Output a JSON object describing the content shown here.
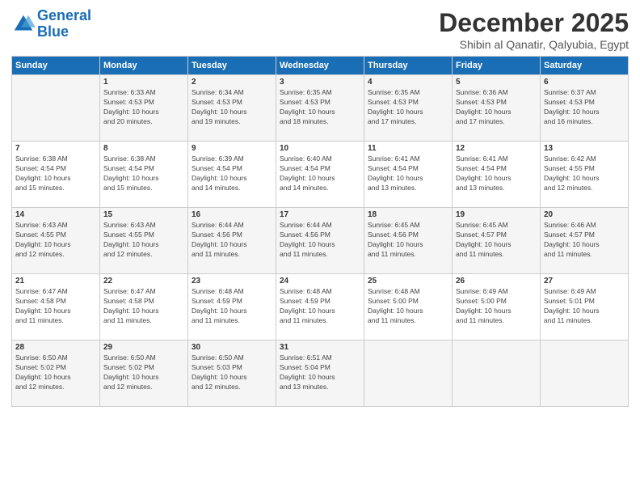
{
  "logo": {
    "line1": "General",
    "line2": "Blue"
  },
  "title": "December 2025",
  "subtitle": "Shibin al Qanatir, Qalyubia, Egypt",
  "days_of_week": [
    "Sunday",
    "Monday",
    "Tuesday",
    "Wednesday",
    "Thursday",
    "Friday",
    "Saturday"
  ],
  "weeks": [
    [
      {
        "day": "",
        "info": ""
      },
      {
        "day": "1",
        "info": "Sunrise: 6:33 AM\nSunset: 4:53 PM\nDaylight: 10 hours\nand 20 minutes."
      },
      {
        "day": "2",
        "info": "Sunrise: 6:34 AM\nSunset: 4:53 PM\nDaylight: 10 hours\nand 19 minutes."
      },
      {
        "day": "3",
        "info": "Sunrise: 6:35 AM\nSunset: 4:53 PM\nDaylight: 10 hours\nand 18 minutes."
      },
      {
        "day": "4",
        "info": "Sunrise: 6:35 AM\nSunset: 4:53 PM\nDaylight: 10 hours\nand 17 minutes."
      },
      {
        "day": "5",
        "info": "Sunrise: 6:36 AM\nSunset: 4:53 PM\nDaylight: 10 hours\nand 17 minutes."
      },
      {
        "day": "6",
        "info": "Sunrise: 6:37 AM\nSunset: 4:53 PM\nDaylight: 10 hours\nand 16 minutes."
      }
    ],
    [
      {
        "day": "7",
        "info": "Sunrise: 6:38 AM\nSunset: 4:54 PM\nDaylight: 10 hours\nand 15 minutes."
      },
      {
        "day": "8",
        "info": "Sunrise: 6:38 AM\nSunset: 4:54 PM\nDaylight: 10 hours\nand 15 minutes."
      },
      {
        "day": "9",
        "info": "Sunrise: 6:39 AM\nSunset: 4:54 PM\nDaylight: 10 hours\nand 14 minutes."
      },
      {
        "day": "10",
        "info": "Sunrise: 6:40 AM\nSunset: 4:54 PM\nDaylight: 10 hours\nand 14 minutes."
      },
      {
        "day": "11",
        "info": "Sunrise: 6:41 AM\nSunset: 4:54 PM\nDaylight: 10 hours\nand 13 minutes."
      },
      {
        "day": "12",
        "info": "Sunrise: 6:41 AM\nSunset: 4:54 PM\nDaylight: 10 hours\nand 13 minutes."
      },
      {
        "day": "13",
        "info": "Sunrise: 6:42 AM\nSunset: 4:55 PM\nDaylight: 10 hours\nand 12 minutes."
      }
    ],
    [
      {
        "day": "14",
        "info": "Sunrise: 6:43 AM\nSunset: 4:55 PM\nDaylight: 10 hours\nand 12 minutes."
      },
      {
        "day": "15",
        "info": "Sunrise: 6:43 AM\nSunset: 4:55 PM\nDaylight: 10 hours\nand 12 minutes."
      },
      {
        "day": "16",
        "info": "Sunrise: 6:44 AM\nSunset: 4:56 PM\nDaylight: 10 hours\nand 11 minutes."
      },
      {
        "day": "17",
        "info": "Sunrise: 6:44 AM\nSunset: 4:56 PM\nDaylight: 10 hours\nand 11 minutes."
      },
      {
        "day": "18",
        "info": "Sunrise: 6:45 AM\nSunset: 4:56 PM\nDaylight: 10 hours\nand 11 minutes."
      },
      {
        "day": "19",
        "info": "Sunrise: 6:45 AM\nSunset: 4:57 PM\nDaylight: 10 hours\nand 11 minutes."
      },
      {
        "day": "20",
        "info": "Sunrise: 6:46 AM\nSunset: 4:57 PM\nDaylight: 10 hours\nand 11 minutes."
      }
    ],
    [
      {
        "day": "21",
        "info": "Sunrise: 6:47 AM\nSunset: 4:58 PM\nDaylight: 10 hours\nand 11 minutes."
      },
      {
        "day": "22",
        "info": "Sunrise: 6:47 AM\nSunset: 4:58 PM\nDaylight: 10 hours\nand 11 minutes."
      },
      {
        "day": "23",
        "info": "Sunrise: 6:48 AM\nSunset: 4:59 PM\nDaylight: 10 hours\nand 11 minutes."
      },
      {
        "day": "24",
        "info": "Sunrise: 6:48 AM\nSunset: 4:59 PM\nDaylight: 10 hours\nand 11 minutes."
      },
      {
        "day": "25",
        "info": "Sunrise: 6:48 AM\nSunset: 5:00 PM\nDaylight: 10 hours\nand 11 minutes."
      },
      {
        "day": "26",
        "info": "Sunrise: 6:49 AM\nSunset: 5:00 PM\nDaylight: 10 hours\nand 11 minutes."
      },
      {
        "day": "27",
        "info": "Sunrise: 6:49 AM\nSunset: 5:01 PM\nDaylight: 10 hours\nand 11 minutes."
      }
    ],
    [
      {
        "day": "28",
        "info": "Sunrise: 6:50 AM\nSunset: 5:02 PM\nDaylight: 10 hours\nand 12 minutes."
      },
      {
        "day": "29",
        "info": "Sunrise: 6:50 AM\nSunset: 5:02 PM\nDaylight: 10 hours\nand 12 minutes."
      },
      {
        "day": "30",
        "info": "Sunrise: 6:50 AM\nSunset: 5:03 PM\nDaylight: 10 hours\nand 12 minutes."
      },
      {
        "day": "31",
        "info": "Sunrise: 6:51 AM\nSunset: 5:04 PM\nDaylight: 10 hours\nand 13 minutes."
      },
      {
        "day": "",
        "info": ""
      },
      {
        "day": "",
        "info": ""
      },
      {
        "day": "",
        "info": ""
      }
    ]
  ]
}
